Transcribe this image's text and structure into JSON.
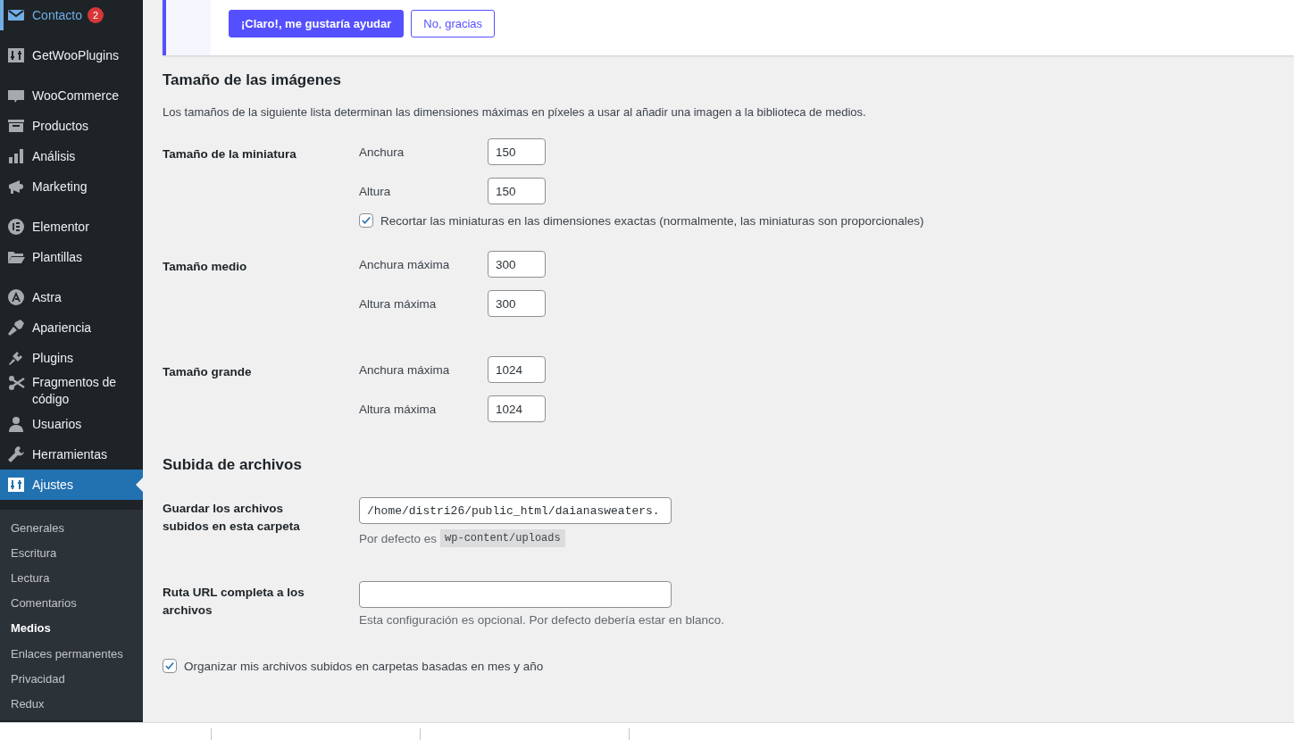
{
  "sidebar": {
    "groups": [
      [
        {
          "label": "Contacto",
          "badge": "2",
          "focused": true,
          "selected": false
        }
      ],
      [
        {
          "label": "GetWooPlugins",
          "focused": false,
          "selected": false
        }
      ],
      [
        {
          "label": "WooCommerce",
          "focused": false,
          "selected": false
        },
        {
          "label": "Productos",
          "focused": false,
          "selected": false
        },
        {
          "label": "Análisis",
          "focused": false,
          "selected": false
        },
        {
          "label": "Marketing",
          "focused": false,
          "selected": false
        }
      ],
      [
        {
          "label": "Elementor",
          "focused": false,
          "selected": false
        },
        {
          "label": "Plantillas",
          "focused": false,
          "selected": false
        }
      ],
      [
        {
          "label": "Astra",
          "focused": false,
          "selected": false
        },
        {
          "label": "Apariencia",
          "focused": false,
          "selected": false
        },
        {
          "label": "Plugins",
          "focused": false,
          "selected": false
        },
        {
          "label": "Fragmentos de código",
          "focused": false,
          "selected": false
        },
        {
          "label": "Usuarios",
          "focused": false,
          "selected": false
        },
        {
          "label": "Herramientas",
          "focused": false,
          "selected": false
        },
        {
          "label": "Ajustes",
          "focused": false,
          "selected": true
        }
      ]
    ],
    "submenu": [
      {
        "label": "Generales",
        "selected": false
      },
      {
        "label": "Escritura",
        "selected": false
      },
      {
        "label": "Lectura",
        "selected": false
      },
      {
        "label": "Comentarios",
        "selected": false
      },
      {
        "label": "Medios",
        "selected": true
      },
      {
        "label": "Enlaces permanentes",
        "selected": false
      },
      {
        "label": "Privacidad",
        "selected": false
      },
      {
        "label": "Redux",
        "selected": false
      }
    ]
  },
  "notice": {
    "buttons": [
      {
        "label": "¡Claro!, me gustaría ayudar",
        "kind": "primary"
      },
      {
        "label": "No, gracias",
        "kind": "secondary"
      }
    ]
  },
  "image_sizes": {
    "title": "Tamaño de las imágenes",
    "description": "Los tamaños de la siguiente lista determinan las dimensiones máximas en píxeles a usar al añadir una imagen a la biblioteca de medios.",
    "rows": [
      {
        "label": "Tamaño de la miniatura",
        "fields": [
          {
            "label": "Anchura",
            "value": "150"
          },
          {
            "label": "Altura",
            "value": "150"
          }
        ],
        "checkbox": {
          "label": "Recortar las miniaturas en las dimensiones exactas (normalmente, las miniaturas son proporcionales)",
          "checked": true
        }
      },
      {
        "label": "Tamaño medio",
        "fields": [
          {
            "label": "Anchura máxima",
            "value": "300"
          },
          {
            "label": "Altura máxima",
            "value": "300"
          }
        ]
      },
      {
        "label": "Tamaño grande",
        "fields": [
          {
            "label": "Anchura máxima",
            "value": "1024"
          },
          {
            "label": "Altura máxima",
            "value": "1024"
          }
        ]
      }
    ]
  },
  "uploads": {
    "title": "Subida de archivos",
    "rows": [
      {
        "label": "Guardar los archivos subidos en esta carpeta",
        "value": "/home/distri26/public_html/daianasweaters.",
        "description": "Por defecto es",
        "default_path": "wp-content/uploads"
      },
      {
        "label": "Ruta URL completa a los archivos",
        "description": "Esta configuración es opcional. Por defecto debería estar en blanco."
      }
    ],
    "organize": {
      "label": "Organizar mis archivos subidos en carpetas basadas en mes y año",
      "checked": true
    }
  }
}
